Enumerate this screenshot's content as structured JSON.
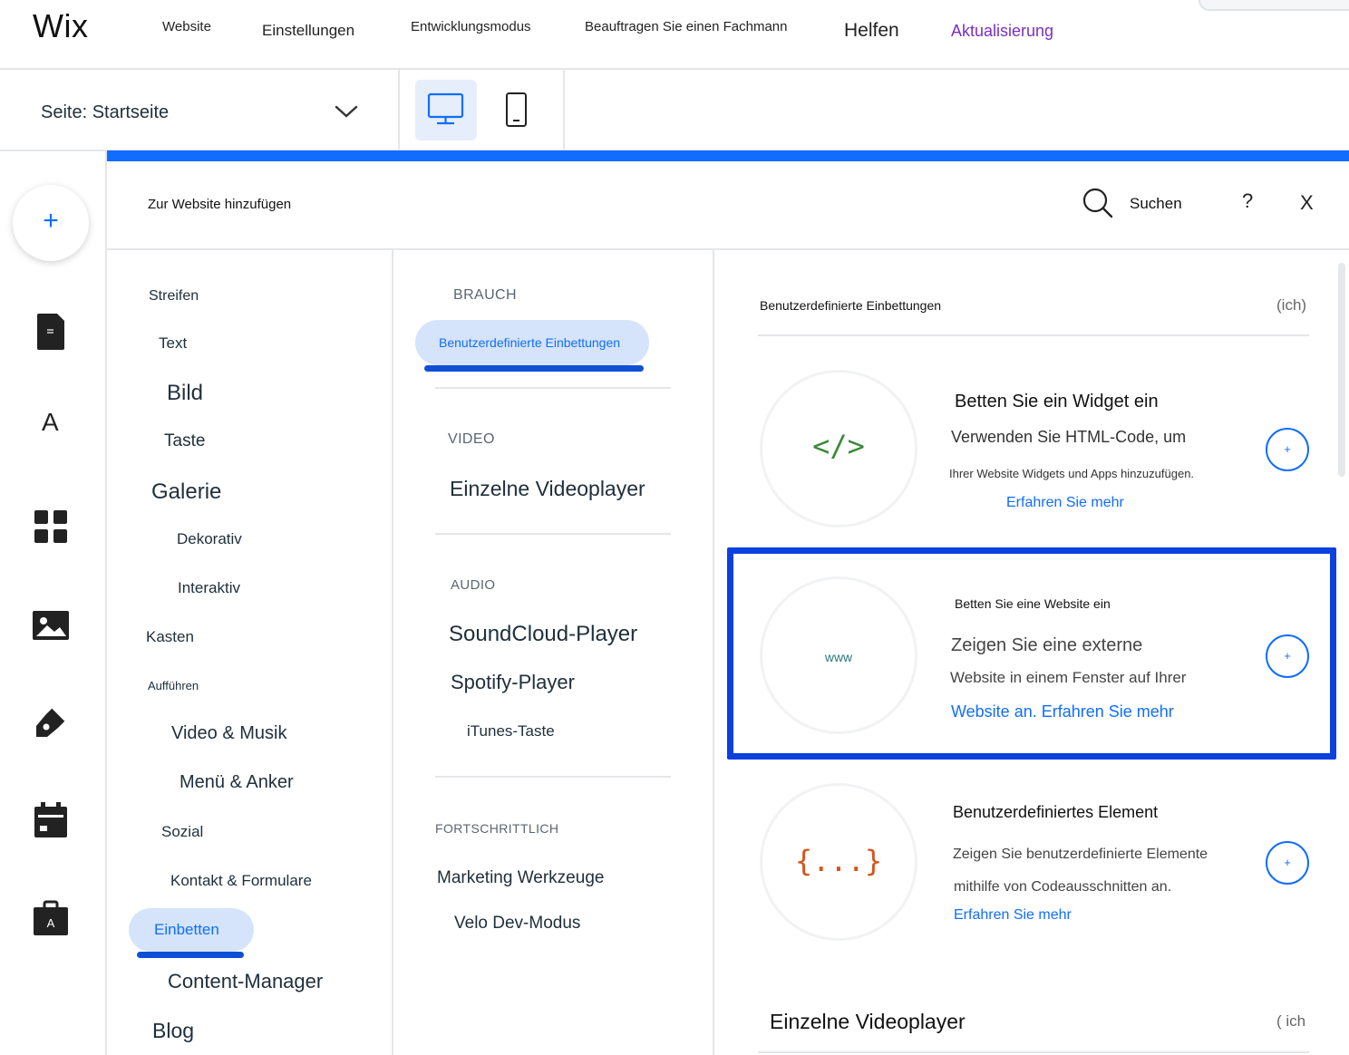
{
  "topbar": {
    "logo": "Wix",
    "menu": [
      "Website",
      "Einstellungen",
      "Entwicklungsmodus",
      "Beauftragen Sie einen Fachmann",
      "Helfen",
      "Aktualisierung"
    ]
  },
  "pagebar": {
    "page_label": "Seite: Startseite"
  },
  "panel": {
    "title": "Zur Website hinzufügen",
    "search_label": "Suchen",
    "help": "?",
    "close": "X"
  },
  "categories": [
    "Streifen",
    "Text",
    "Bild",
    "Taste",
    "Galerie",
    "Dekorativ",
    "Interaktiv",
    "Kasten",
    "Aufführen",
    "Video & Musik",
    "Menü & Anker",
    "Sozial",
    "Kontakt & Formulare",
    "Einbetten",
    "Content-Manager",
    "Blog"
  ],
  "selected_category": "Einbetten",
  "subcategories": {
    "brauch": {
      "title": "BRAUCH",
      "items": [
        "Benutzerdefinierte Einbettungen"
      ]
    },
    "video": {
      "title": "VIDEO",
      "items": [
        "Einzelne Videoplayer"
      ]
    },
    "audio": {
      "title": "AUDIO",
      "items": [
        "SoundCloud-Player",
        "Spotify-Player",
        "iTunes-Taste"
      ]
    },
    "advanced": {
      "title": "FORTSCHRITTLICH",
      "items": [
        "Marketing Werkzeuge",
        "Velo Dev-Modus"
      ]
    }
  },
  "content": {
    "section_title": "Benutzerdefinierte Einbettungen",
    "section_info": "(ich)",
    "cards": [
      {
        "icon_text": "</>",
        "title": "Betten Sie ein Widget ein",
        "desc1": "Verwenden Sie HTML-Code, um",
        "desc2": "Ihrer Website Widgets und Apps hinzuzufügen.",
        "link": "Erfahren Sie mehr",
        "icon_color": "#3c8a3c"
      },
      {
        "icon_text": "www",
        "title": "Betten Sie eine Website ein",
        "desc1": "Zeigen Sie eine externe",
        "desc2": "Website in einem Fenster auf Ihrer",
        "link": "Website an. Erfahren Sie mehr",
        "icon_color": "#2c7a7a"
      },
      {
        "icon_text": "{...}",
        "title": "Benutzerdefiniertes Element",
        "desc1": "Zeigen Sie benutzerdefinierte Elemente",
        "desc2": "mithilfe von Codeausschnitten an.",
        "link": "Erfahren Sie mehr",
        "icon_color": "#d4541c"
      }
    ],
    "next_section_title": "Einzelne Videoplayer",
    "next_section_info": "( ich"
  },
  "colors": {
    "accent": "#116dff",
    "highlight": "#0a41e0",
    "upgrade": "#7b2fbf"
  }
}
